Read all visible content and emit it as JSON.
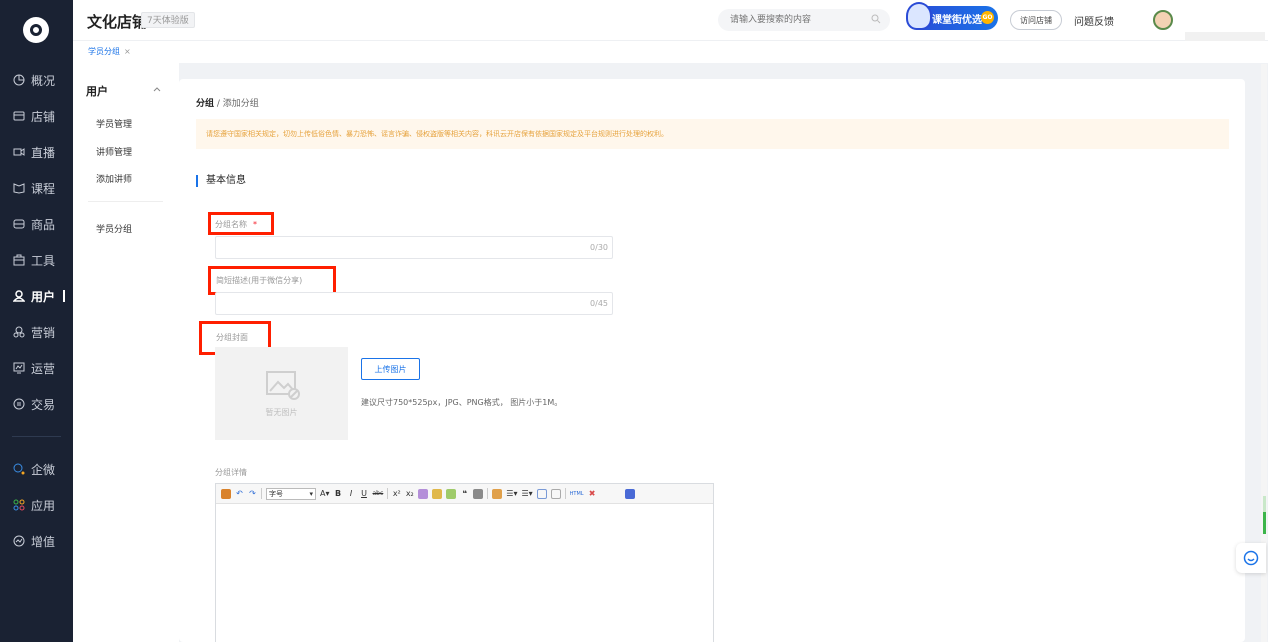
{
  "sidebar": {
    "items": [
      {
        "label": "概况",
        "icon": "pie-chart-icon"
      },
      {
        "label": "店铺",
        "icon": "store-icon"
      },
      {
        "label": "直播",
        "icon": "live-video-icon"
      },
      {
        "label": "课程",
        "icon": "book-icon"
      },
      {
        "label": "商品",
        "icon": "goods-icon"
      },
      {
        "label": "工具",
        "icon": "toolbox-icon"
      },
      {
        "label": "用户",
        "icon": "user-icon",
        "active": true
      },
      {
        "label": "营销",
        "icon": "marketing-icon"
      },
      {
        "label": "运营",
        "icon": "operation-icon"
      },
      {
        "label": "交易",
        "icon": "trade-icon"
      },
      {
        "label": "企微",
        "icon": "wecom-icon"
      },
      {
        "label": "应用",
        "icon": "apps-icon"
      },
      {
        "label": "增值",
        "icon": "value-added-icon"
      }
    ]
  },
  "header": {
    "shop_name": "文化店铺",
    "trial_badge": "7天体验版",
    "search_placeholder": "请输入要搜索的内容",
    "promo_label": "课堂街优选",
    "promo_badge": "GO",
    "visit_store": "访问店铺",
    "feedback": "问题反馈"
  },
  "tabs": [
    {
      "label": "学员分组"
    }
  ],
  "subnav": {
    "heading": "用户",
    "links": [
      "学员管理",
      "讲师管理",
      "添加讲师",
      "学员分组"
    ]
  },
  "main": {
    "breadcrumb_parent": "分组",
    "breadcrumb_current": "添加分组",
    "notice": "请您遵守国家相关规定，切勿上传低俗色情、暴力恐怖、谣言诈骗、侵权盗版等相关内容，科讯云开店保有依据国家规定及平台规则进行处理的权利。",
    "section_title": "基本信息",
    "group_name_label": "分组名称",
    "group_name_required": "*",
    "group_name_count": "0/30",
    "short_desc_label": "简短描述(用于微信分享)",
    "short_desc_count": "0/45",
    "cover_label": "分组封面",
    "no_image": "暂无图片",
    "upload_btn": "上传图片",
    "upload_hint": "建议尺寸750*525px，JPG、PNG格式， 图片小于1M。",
    "detail_label": "分组详情",
    "font_size_select": "字号"
  },
  "colors": {
    "accent": "#1a73e8",
    "sidebar_bg": "#1a2233",
    "highlight": "#ff1f00",
    "notice_text": "#e6a23c"
  }
}
